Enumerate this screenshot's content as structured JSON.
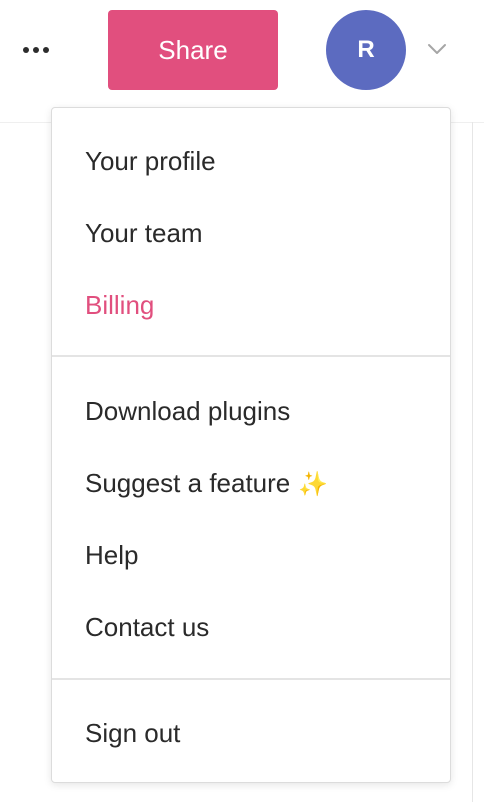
{
  "header": {
    "share_label": "Share",
    "avatar_initial": "R"
  },
  "menu": {
    "groups": [
      {
        "items": [
          {
            "label": "Your profile"
          },
          {
            "label": "Your team"
          },
          {
            "label": "Billing",
            "color": "#e14f7e"
          }
        ]
      },
      {
        "items": [
          {
            "label": "Download plugins"
          },
          {
            "label": "Suggest a feature",
            "icon": "sparkles-icon"
          },
          {
            "label": "Help"
          },
          {
            "label": "Contact us"
          }
        ]
      },
      {
        "items": [
          {
            "label": "Sign out"
          }
        ]
      }
    ]
  },
  "colors": {
    "accent": "#e14f7e",
    "avatar": "#5c6bc0",
    "text": "#2a2a2a"
  }
}
